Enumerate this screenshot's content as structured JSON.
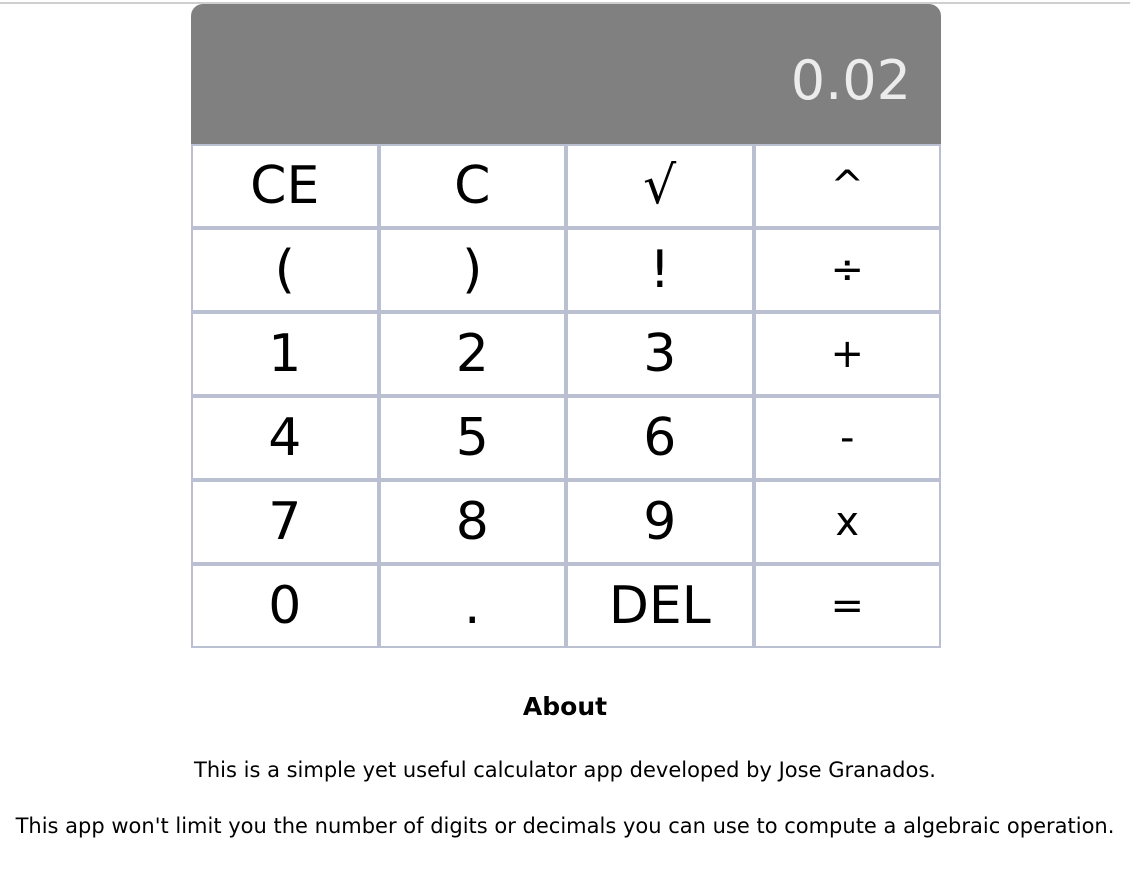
{
  "display": {
    "value": "0.02"
  },
  "keys": [
    [
      "CE",
      "C",
      "√",
      "^"
    ],
    [
      "(",
      ")",
      "!",
      "÷"
    ],
    [
      "1",
      "2",
      "3",
      "+"
    ],
    [
      "4",
      "5",
      "6",
      "-"
    ],
    [
      "7",
      "8",
      "9",
      "x"
    ],
    [
      "0",
      ".",
      "DEL",
      "="
    ]
  ],
  "about": {
    "title": "About",
    "p1": "This is a simple yet useful calculator app developed by Jose Granados.",
    "p2": "This app won't limit you the number of digits or decimals you can use to compute a algebraic operation."
  }
}
